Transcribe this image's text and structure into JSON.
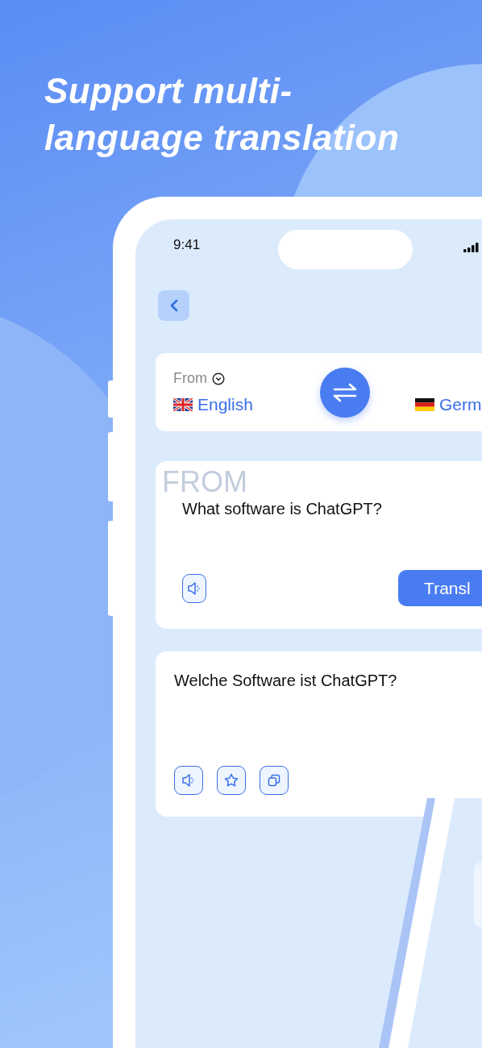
{
  "headline": "Support multi-language translation",
  "status_bar": {
    "time": "9:41"
  },
  "language_card": {
    "from_label": "From",
    "from_language": "English",
    "to_language": "Germ"
  },
  "source_card": {
    "watermark": "FROM",
    "text": "What software is ChatGPT?",
    "translate_button": "Transl"
  },
  "result_card": {
    "text": "Welche Software ist ChatGPT?",
    "actions": [
      {
        "kind": "speaker"
      },
      {
        "kind": "star"
      },
      {
        "kind": "copy"
      }
    ]
  }
}
